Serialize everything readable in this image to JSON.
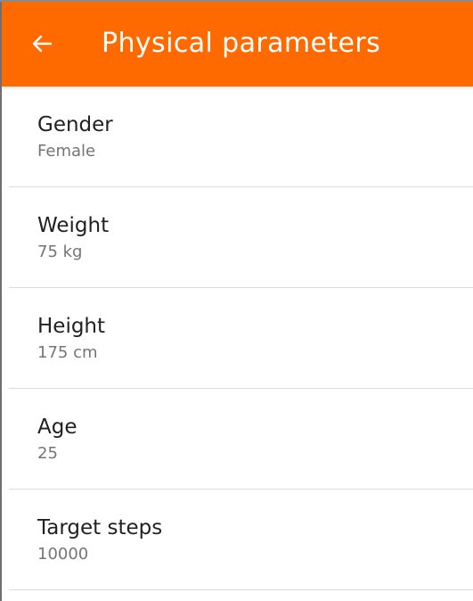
{
  "header": {
    "title": "Physical parameters",
    "back_icon": "arrow-left-icon",
    "background_color": "#ff6a00"
  },
  "settings": [
    {
      "label": "Gender",
      "value": "Female"
    },
    {
      "label": "Weight",
      "value": "75 kg"
    },
    {
      "label": "Height",
      "value": "175 cm"
    },
    {
      "label": "Age",
      "value": "25"
    },
    {
      "label": "Target steps",
      "value": "10000"
    }
  ]
}
